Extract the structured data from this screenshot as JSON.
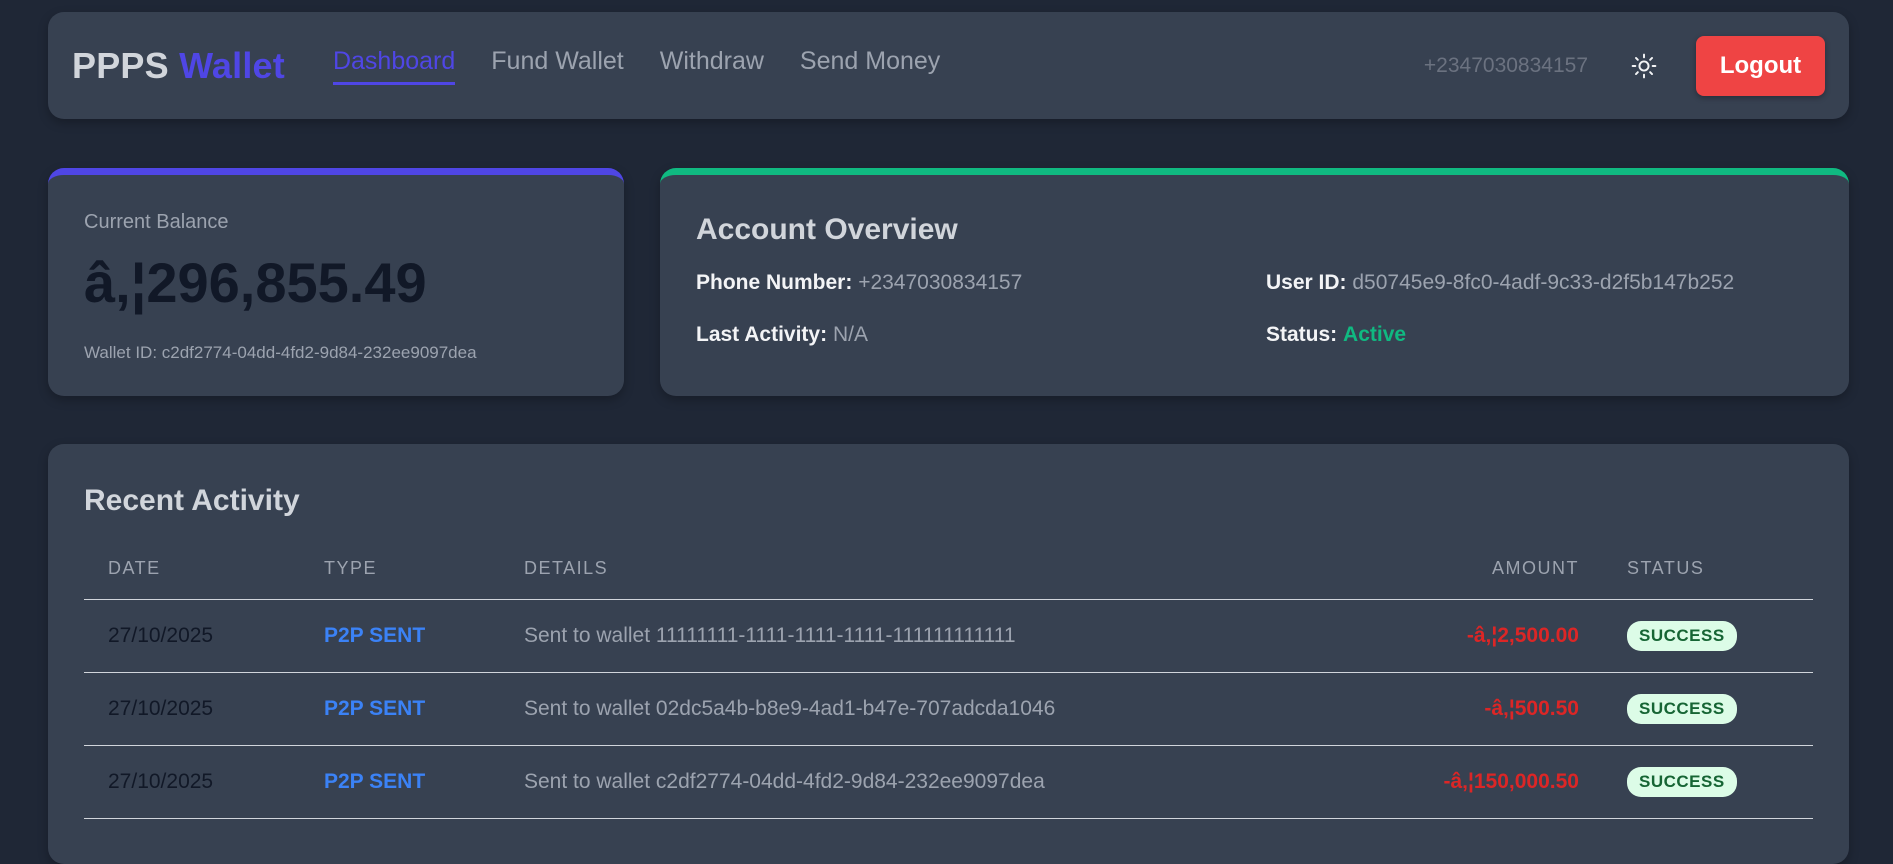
{
  "nav": {
    "brand_main": "PPPS",
    "brand_accent": "Wallet",
    "links": [
      "Dashboard",
      "Fund Wallet",
      "Withdraw",
      "Send Money"
    ],
    "phone": "+2347030834157",
    "theme_icon": "sun-icon",
    "logout_label": "Logout"
  },
  "balance": {
    "label": "Current Balance",
    "value": "â‚¦296,855.49",
    "wallet_id": "Wallet ID: c2df2774-04dd-4fd2-9d84-232ee9097dea"
  },
  "overview": {
    "title": "Account Overview",
    "phone_label": "Phone Number:",
    "phone_value": "+2347030834157",
    "user_label": "User ID:",
    "user_value": "d50745e9-8fc0-4adf-9c33-d2f5b147b252",
    "activity_label": "Last Activity:",
    "activity_value": "N/A",
    "status_label": "Status:",
    "status_value": "Active"
  },
  "activity": {
    "title": "Recent Activity",
    "columns": [
      "DATE",
      "TYPE",
      "DETAILS",
      "AMOUNT",
      "STATUS"
    ],
    "rows": [
      {
        "date": "27/10/2025",
        "type": "P2P SENT",
        "details": "Sent to wallet 11111111-1111-1111-1111-111111111111",
        "amount": "-â‚¦2,500.00",
        "status": "SUCCESS"
      },
      {
        "date": "27/10/2025",
        "type": "P2P SENT",
        "details": "Sent to wallet 02dc5a4b-b8e9-4ad1-b47e-707adcda1046",
        "amount": "-â‚¦500.50",
        "status": "SUCCESS"
      },
      {
        "date": "27/10/2025",
        "type": "P2P SENT",
        "details": "Sent to wallet c2df2774-04dd-4fd2-9d84-232ee9097dea",
        "amount": "-â‚¦150,000.50",
        "status": "SUCCESS"
      }
    ]
  },
  "colors": {
    "accent": "#4f46e5",
    "success": "#10b981",
    "danger": "#ef4444",
    "link": "#3b82f6"
  }
}
